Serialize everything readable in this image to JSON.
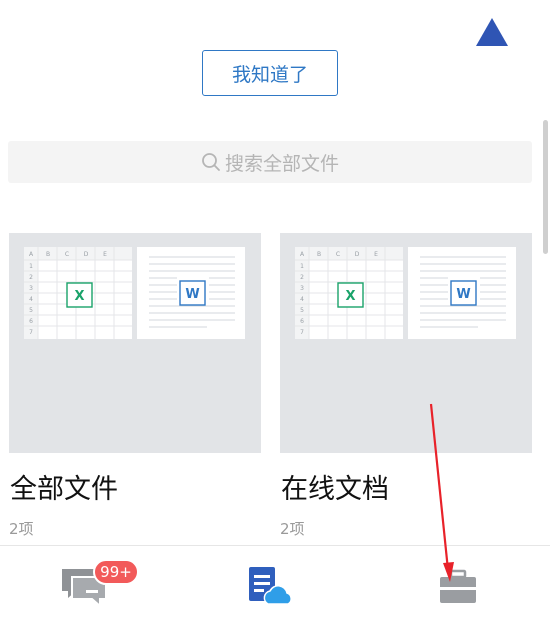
{
  "top_button": {
    "label": "我知道了"
  },
  "search": {
    "placeholder": "搜索全部文件"
  },
  "cards": [
    {
      "title": "全部文件",
      "count": "2项"
    },
    {
      "title": "在线文档",
      "count": "2项"
    }
  ],
  "thumbnails": {
    "sheet_cols": [
      "A",
      "B",
      "C",
      "D",
      "E"
    ],
    "sheet_rows": [
      "1",
      "2",
      "3",
      "4",
      "5",
      "6",
      "7"
    ],
    "sheet_mark": "X",
    "doc_mark": "W"
  },
  "bottom_nav": {
    "messages_badge": "99+",
    "items": [
      {
        "icon": "message-icon"
      },
      {
        "icon": "cloud-document-icon"
      },
      {
        "icon": "briefcase-icon"
      }
    ]
  },
  "colors": {
    "accent": "#2f78c5",
    "badge": "#f25a5a",
    "sheet_green": "#1aa36a",
    "doc_blue": "#2f78c5",
    "triangle": "#2f55b4",
    "annotation_arrow": "#e8222a"
  }
}
